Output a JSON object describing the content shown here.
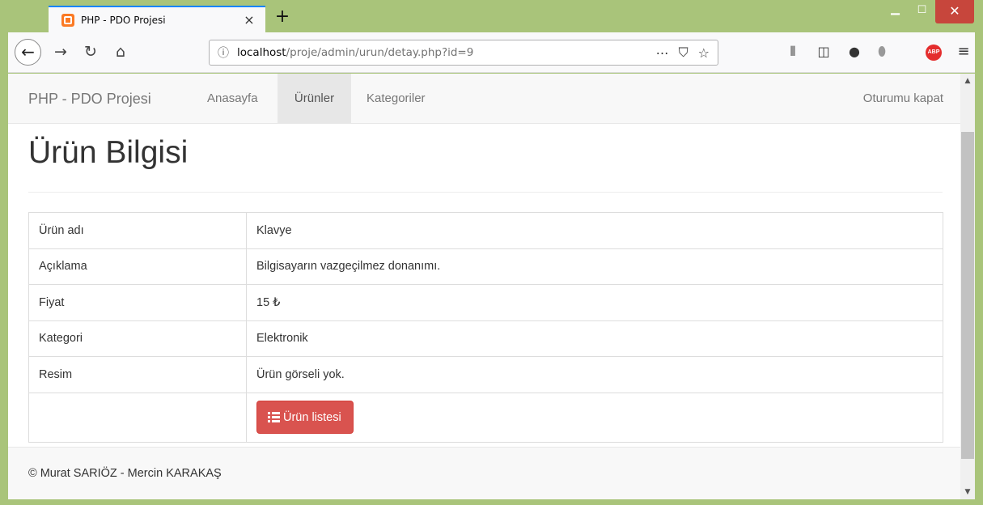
{
  "browser": {
    "tab_title": "PHP - PDO Projesi",
    "tab_close": "×",
    "new_tab": "+",
    "url_host": "localhost",
    "url_path": "/proje/admin/urun/detay.php?id=9",
    "icons": [
      "back-arrow-icon",
      "forward-arrow-icon",
      "reload-icon",
      "home-icon",
      "info-icon",
      "more-icon",
      "pocket-icon",
      "bookmark-star-icon",
      "library-icon",
      "sidebar-icon",
      "extension-icon",
      "shield-icon",
      "abp-icon",
      "menu-icon"
    ],
    "abp_label": "ABP"
  },
  "navbar": {
    "brand": "PHP - PDO Projesi",
    "links": [
      "Anasayfa",
      "Ürünler",
      "Kategoriler"
    ],
    "active_link": "Ürünler",
    "logout": "Oturumu kapat"
  },
  "page": {
    "title": "Ürün Bilgisi"
  },
  "product": {
    "rows": [
      {
        "label": "Ürün adı",
        "value": "Klavye"
      },
      {
        "label": "Açıklama",
        "value": "Bilgisayarın vazgeçilmez donanımı."
      },
      {
        "label": "Fiyat",
        "value": "15 ₺"
      },
      {
        "label": "Kategori",
        "value": "Elektronik"
      },
      {
        "label": "Resim",
        "value": "Ürün görseli yok."
      }
    ],
    "list_button": "Ürün listesi"
  },
  "footer": {
    "text": "© Murat SARIÖZ - Mercin KARAKAŞ"
  },
  "colors": {
    "window_frame": "#a9c47a",
    "danger": "#d9534f",
    "navbar_bg": "#f8f8f8"
  }
}
